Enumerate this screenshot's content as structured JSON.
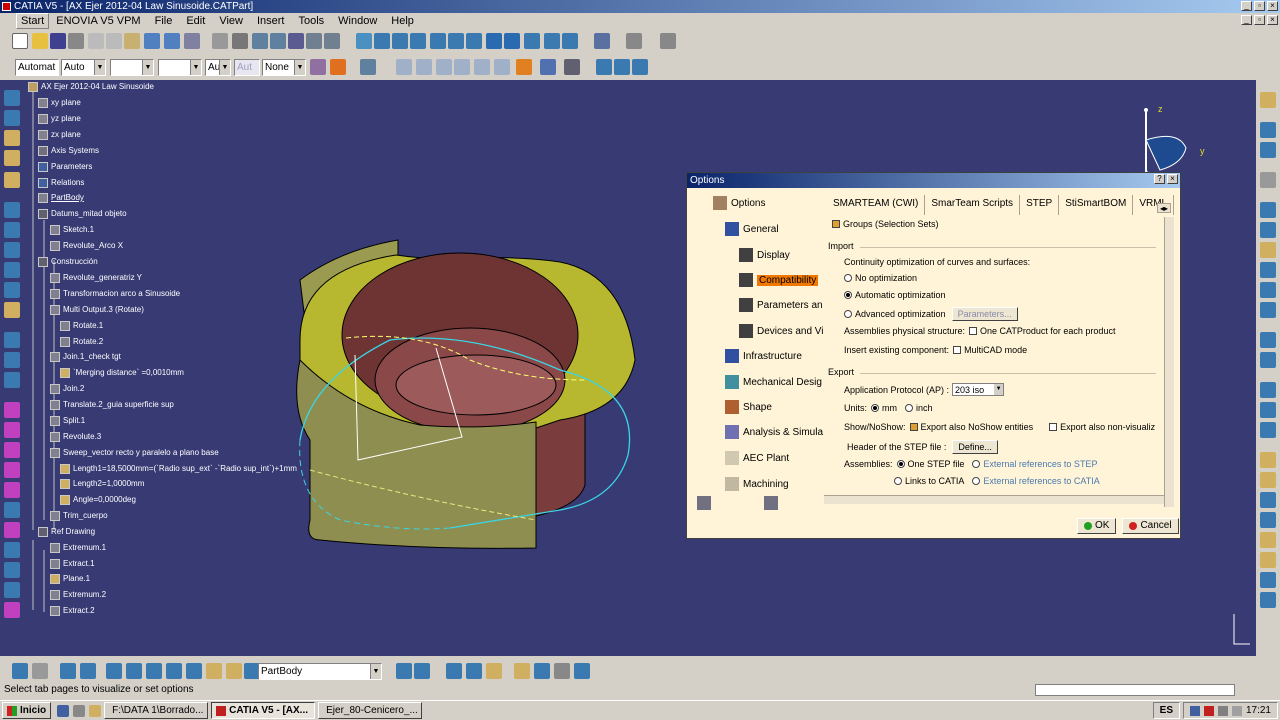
{
  "window": {
    "title": "CATIA V5 - [AX Ejer 2012-04 Law Sinusoide.CATPart]"
  },
  "menu": {
    "start": "Start",
    "items": [
      "ENOVIA V5 VPM",
      "File",
      "Edit",
      "View",
      "Insert",
      "Tools",
      "Window",
      "Help"
    ]
  },
  "toolbar2": {
    "combo1": "Automat",
    "combo2": "Auto",
    "combo5": "Aut",
    "combo6": "Aut",
    "combo7": "None"
  },
  "tree": {
    "items": [
      "AX Ejer 2012-04 Law Sinusoide",
      "xy plane",
      "yz plane",
      "zx plane",
      "Axis Systems",
      "Parameters",
      "Relations",
      "PartBody",
      "Datums_mitad objeto",
      "Sketch.1",
      "Revolute_Arco X",
      "Construcción",
      "Revolute_generatriz Y",
      "Transformacion arco a Sinusoide",
      "Multi Output.3 (Rotate)",
      "Rotate.1",
      "Rotate.2",
      "Join.1_check tgt",
      "`Merging distance` =0,0010mm",
      "Join.2",
      "Translate.2_guia superficie sup",
      "Split.1",
      "Revolute.3",
      "Sweep_vector recto y paralelo a plano base",
      "Length1=18,5000mm=(`Radio sup_ext` -`Radio sup_int`)+1mm",
      "Length2=1,0000mm",
      "Angle=0,0000deg",
      "Trim_cuerpo",
      "Ref Drawing",
      "Extremum.1",
      "Extract.1",
      "Plane.1",
      "Extremum.2",
      "Extract.2"
    ]
  },
  "compass": {
    "z": "z",
    "y": "y"
  },
  "dialog": {
    "title": "Options",
    "tree": [
      "Options",
      "General",
      "Display",
      "Compatibility",
      "Parameters an",
      "Devices and Vi",
      "Infrastructure",
      "Mechanical Desig",
      "Shape",
      "Analysis & Simula",
      "AEC Plant",
      "Machining"
    ],
    "tabs": [
      "SMARTEAM (CWI)",
      "SmarTeam Scripts",
      "STEP",
      "StiSmartBOM",
      "VRML"
    ],
    "groups_label": "Groups (Selection Sets)",
    "import_header": "Import",
    "continuity_label": "Continuity optimization of curves and surfaces:",
    "radio_no": "No optimization",
    "radio_auto": "Automatic optimization",
    "radio_adv": "Advanced optimization",
    "parameters_btn": "Parameters...",
    "assemblies_physical": "Assemblies physical structure:",
    "one_catproduct": "One CATProduct for each product",
    "insert_existing": "Insert existing component:",
    "multicad": "MultiCAD mode",
    "export_header": "Export",
    "ap_label": "Application Protocol (AP) :",
    "ap_value": "203 iso",
    "units_label": "Units:",
    "unit_mm": "mm",
    "unit_inch": "inch",
    "show_noshow": "Show/NoShow:",
    "export_noshow": "Export also NoShow entities",
    "export_nonvisual": "Export also non-visualiz",
    "header_step": "Header of the STEP file :",
    "define_btn": "Define...",
    "assemblies_label": "Assemblies:",
    "one_step": "One STEP file",
    "ext_ref_step": "External references to STEP",
    "links_catia": "Links to CATIA",
    "ext_ref_catia": "External references to CATIA",
    "ok": "OK",
    "cancel": "Cancel"
  },
  "bottom_toolbar": {
    "body_select": "PartBody"
  },
  "status": {
    "message": "Select tab pages to visualize or set options"
  },
  "taskbar": {
    "start": "Inicio",
    "tasks": [
      "F:\\DATA 1\\Borrado...",
      "CATIA V5 - [AX...",
      "Ejer_80-Cenicero_..."
    ],
    "lang": "ES",
    "clock": "17:21"
  }
}
